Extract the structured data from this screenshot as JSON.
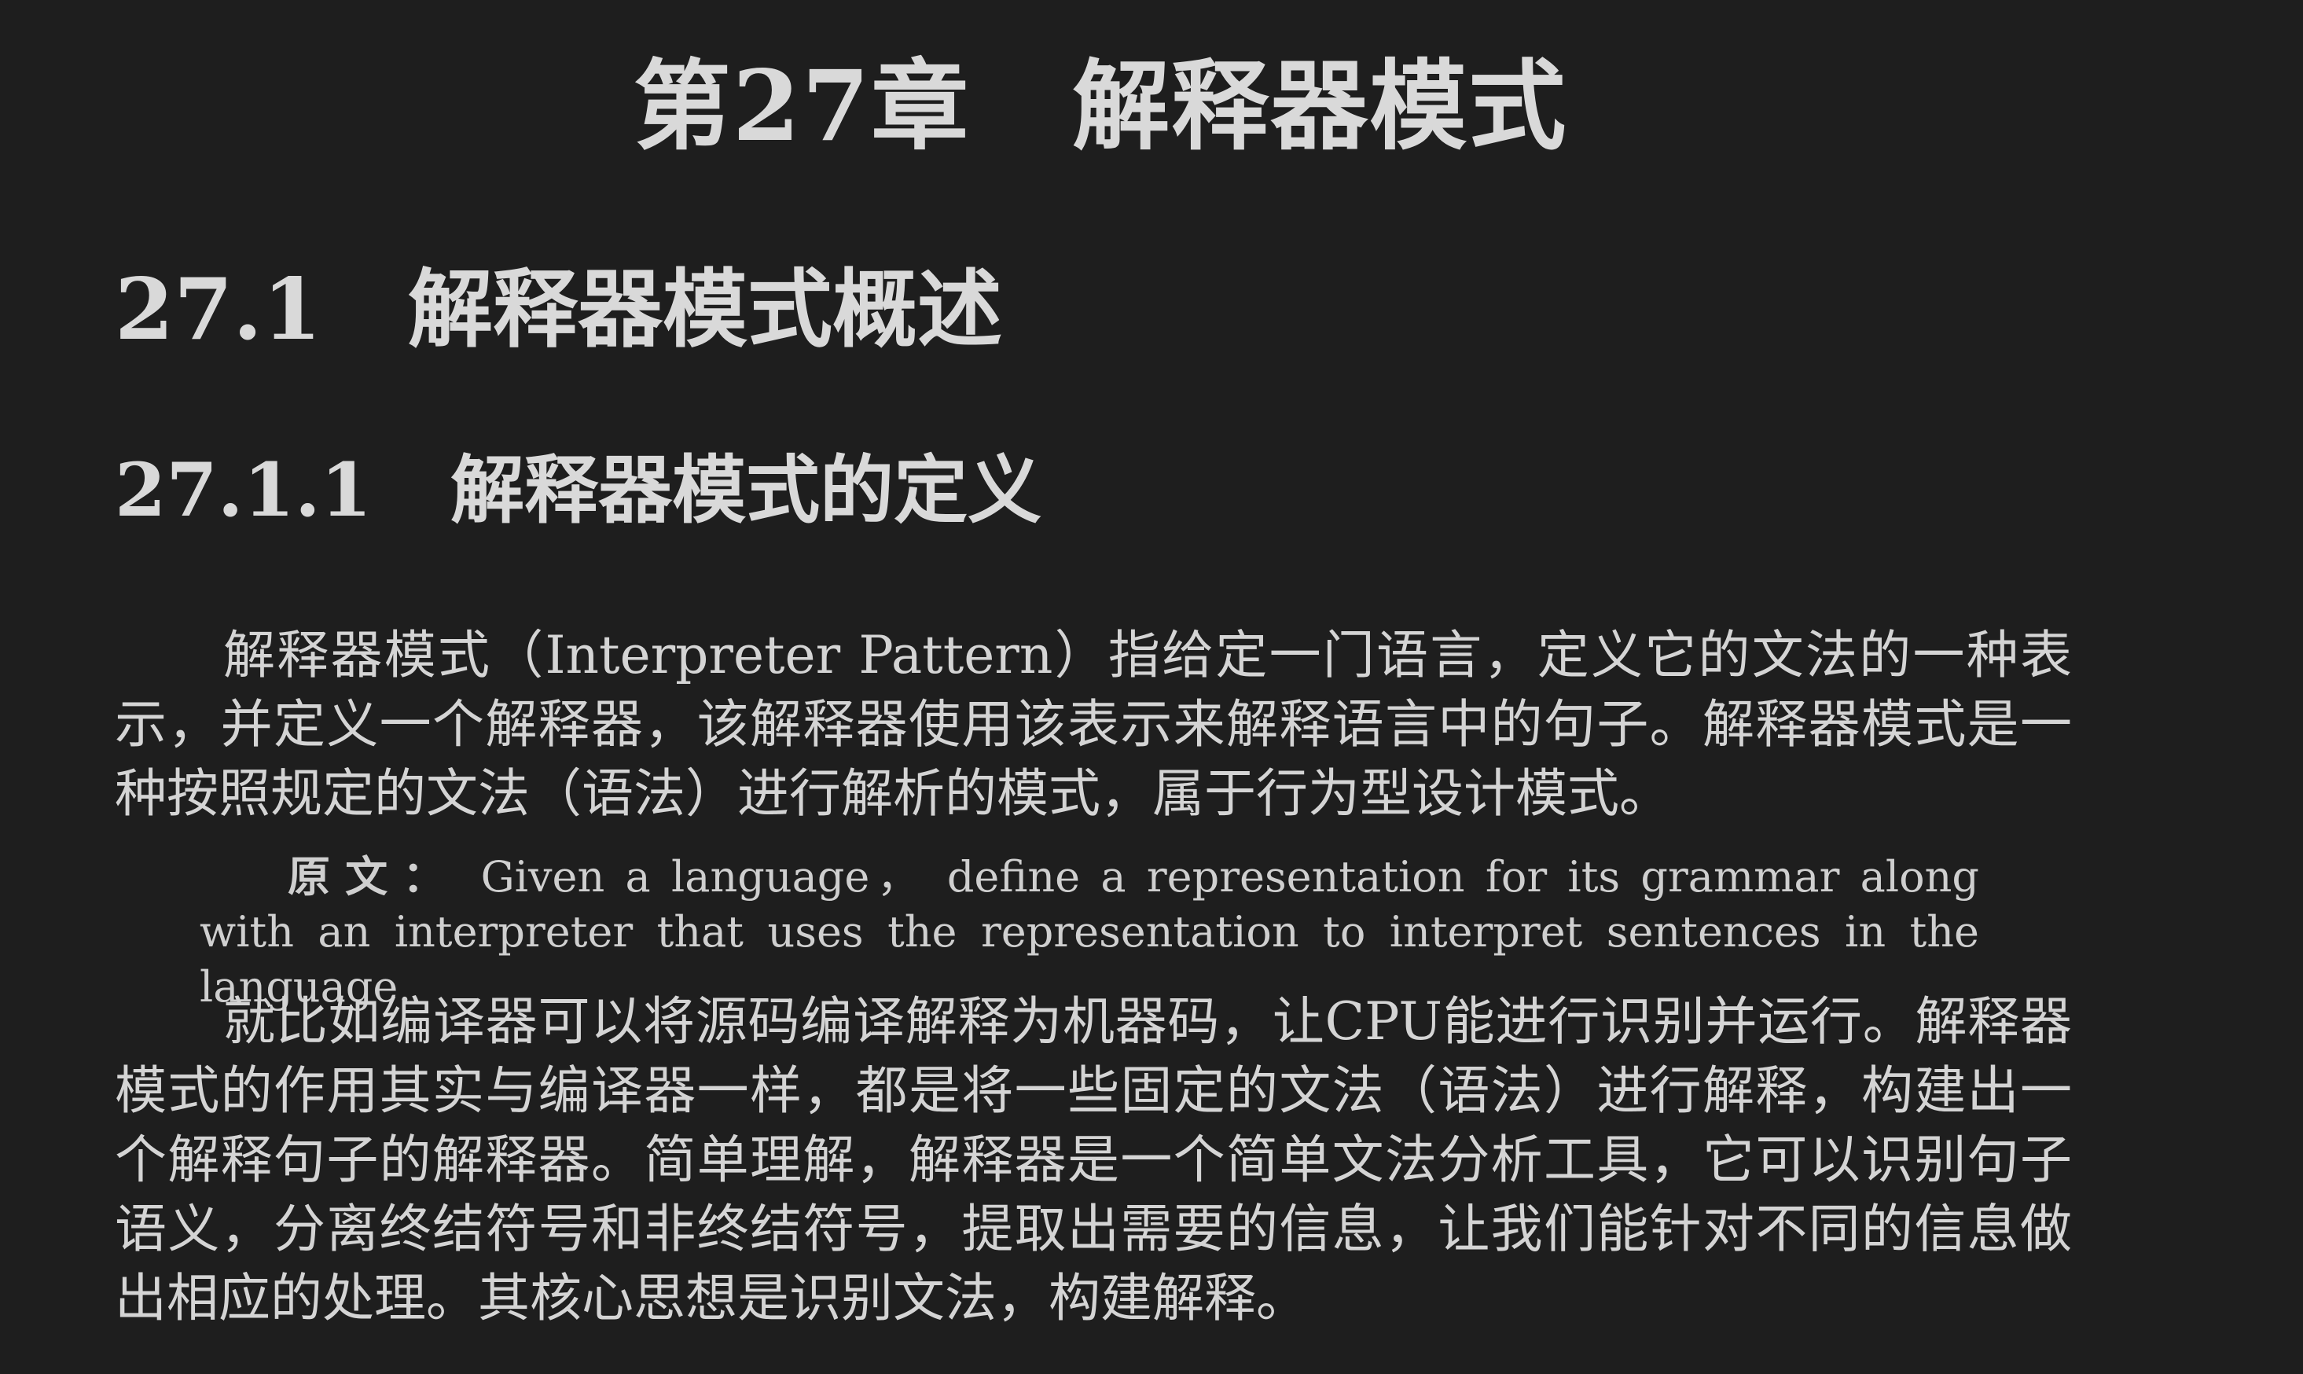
{
  "chapter": {
    "number": "第27章",
    "title": "解释器模式"
  },
  "section": {
    "number": "27.1",
    "title": "解释器模式概述"
  },
  "subsection": {
    "number": "27.1.1",
    "title": "解释器模式的定义"
  },
  "paragraphs": [
    "解释器模式（Interpreter Pattern）指给定一门语言，定义它的文法的一种表示，并定义一个解释器，该解释器使用该表示来解释语言中的句子。解释器模式是一种按照规定的文法（语法）进行解析的模式，属于行为型设计模式。",
    "就比如编译器可以将源码编译解释为机器码，让CPU能进行识别并运行。解释器模式的作用其实与编译器一样，都是将一些固定的文法（语法）进行解释，构建出一个解释句子的解释器。简单理解，解释器是一个简单文法分析工具，它可以识别句子语义，分离终结符号和非终结符号，提取出需要的信息，让我们能针对不同的信息做出相应的处理。其核心思想是识别文法，构建解释。"
  ],
  "quote": {
    "label": "原文：",
    "text": "Given a language， define a representation for its grammar along with an interpreter that uses the representation to interpret sentences in the language."
  }
}
